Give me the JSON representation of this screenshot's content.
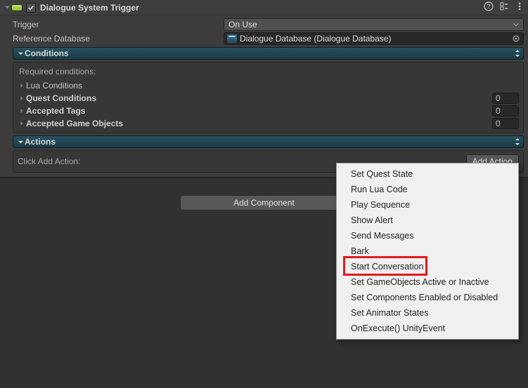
{
  "header": {
    "title": "Dialogue System Trigger",
    "enabled": true
  },
  "fields": {
    "trigger_label": "Trigger",
    "trigger_value": "On Use",
    "ref_db_label": "Reference Database",
    "ref_db_value": "Dialogue Database (Dialogue Database)"
  },
  "conditions": {
    "title": "Conditions",
    "required_label": "Required conditions:",
    "items": [
      {
        "name": "Lua Conditions",
        "bold": false,
        "count": null
      },
      {
        "name": "Quest Conditions",
        "bold": true,
        "count": 0
      },
      {
        "name": "Accepted Tags",
        "bold": true,
        "count": 0
      },
      {
        "name": "Accepted Game Objects",
        "bold": true,
        "count": 0
      }
    ]
  },
  "actions": {
    "title": "Actions",
    "hint": "Click Add Action:",
    "add_button": "Add Action"
  },
  "add_component_label": "Add Component",
  "context_menu": {
    "items": [
      "Set Quest State",
      "Run Lua Code",
      "Play Sequence",
      "Show Alert",
      "Send Messages",
      "Bark",
      "Start Conversation",
      "Set GameObjects Active or Inactive",
      "Set Components Enabled or Disabled",
      "Set Animator States",
      "OnExecute() UnityEvent"
    ],
    "highlighted_index": 6
  }
}
